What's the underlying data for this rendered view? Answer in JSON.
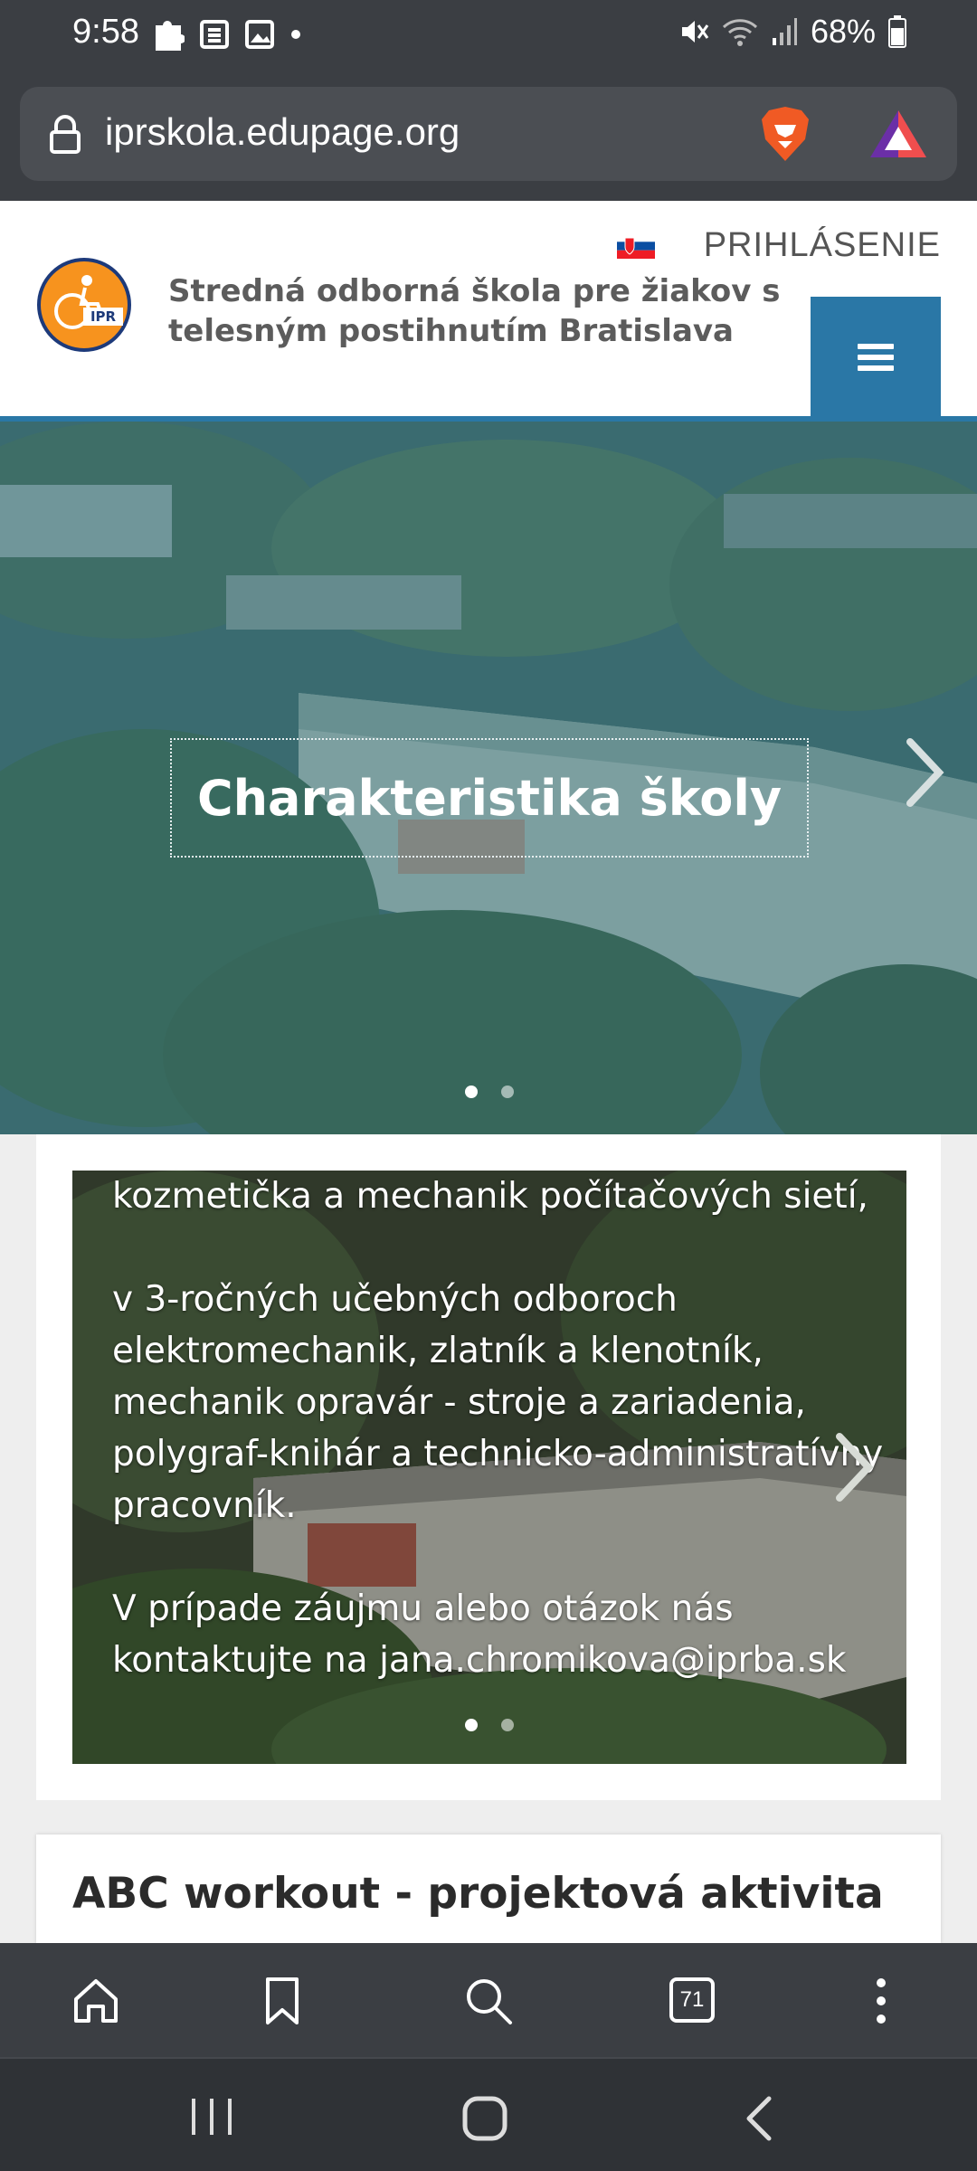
{
  "status_bar": {
    "time": "9:58",
    "battery": "68%"
  },
  "browser": {
    "url": "iprskola.edupage.org",
    "tabs_count": "71"
  },
  "header": {
    "login": "PRIHLÁSENIE",
    "school_name": "Stredná odborná škola pre žiakov s telesným postihnutím Bratislava",
    "accent_color": "#2a77a6"
  },
  "hero": {
    "caption": "Charakteristika školy",
    "slide_count": 2,
    "active_slide": 1
  },
  "slide2": {
    "paragraphs": [
      "kozmetička a mechanik počítačových sietí,",
      "v 3-ročných učebných odboroch elektromechanik, zlatník a klenotník, mechanik opravár - stroje a zariadenia, polygraf-knihár a technicko-administratívny pracovník.",
      "V prípade záujmu alebo otázok nás kontaktujte na jana.chromikova@iprba.sk"
    ]
  },
  "article": {
    "title": "ABC workout - projektová aktivita"
  }
}
